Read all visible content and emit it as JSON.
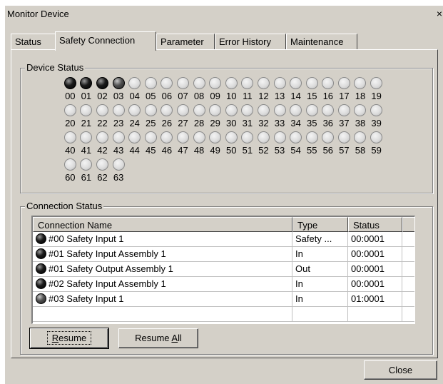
{
  "window": {
    "title": "Monitor Device",
    "close_glyph": "×"
  },
  "tabs": [
    {
      "label": "Status"
    },
    {
      "label": "Safety Connection"
    },
    {
      "label": "Parameter"
    },
    {
      "label": "Error History"
    },
    {
      "label": "Maintenance"
    }
  ],
  "device_status": {
    "label": "Device Status",
    "nodes": [
      "00",
      "01",
      "02",
      "03",
      "04",
      "05",
      "06",
      "07",
      "08",
      "09",
      "10",
      "11",
      "12",
      "13",
      "14",
      "15",
      "16",
      "17",
      "18",
      "19",
      "20",
      "21",
      "22",
      "23",
      "24",
      "25",
      "26",
      "27",
      "28",
      "29",
      "30",
      "31",
      "32",
      "33",
      "34",
      "35",
      "36",
      "37",
      "38",
      "39",
      "40",
      "41",
      "42",
      "43",
      "44",
      "45",
      "46",
      "47",
      "48",
      "49",
      "50",
      "51",
      "52",
      "53",
      "54",
      "55",
      "56",
      "57",
      "58",
      "59",
      "60",
      "61",
      "62",
      "63"
    ],
    "active_nodes": [
      "00",
      "01",
      "02",
      "03"
    ],
    "partial_nodes": [
      "03"
    ]
  },
  "connection_status": {
    "label": "Connection Status",
    "columns": [
      "Connection Name",
      "Type",
      "Status"
    ],
    "rows": [
      {
        "name": "#00 Safety Input 1",
        "type": "Safety ...",
        "status": "00:0001",
        "led": "on"
      },
      {
        "name": "#01 Safety Input Assembly 1",
        "type": "In",
        "status": "00:0001",
        "led": "on"
      },
      {
        "name": "#01 Safety Output Assembly 1",
        "type": "Out",
        "status": "00:0001",
        "led": "on"
      },
      {
        "name": "#02 Safety Input Assembly 1",
        "type": "In",
        "status": "00:0001",
        "led": "on"
      },
      {
        "name": "#03 Safety Input 1",
        "type": "In",
        "status": "01:0001",
        "led": "mid"
      }
    ]
  },
  "buttons": {
    "resume_pre": "",
    "resume_u": "R",
    "resume_post": "esume",
    "resume_all_pre": "Resume ",
    "resume_all_u": "A",
    "resume_all_post": "ll",
    "close": "Close"
  }
}
